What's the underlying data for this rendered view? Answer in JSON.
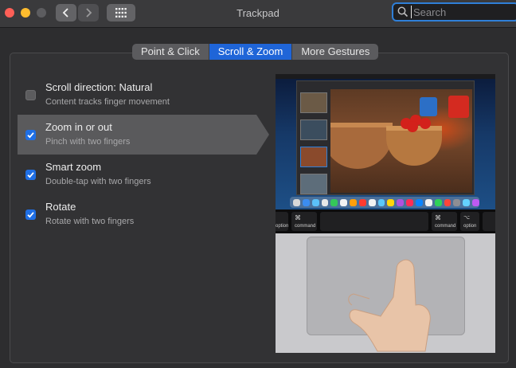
{
  "window": {
    "title": "Trackpad",
    "search": {
      "placeholder": "Search",
      "value": ""
    },
    "back_icon": "chevron-left-icon",
    "forward_icon": "chevron-right-icon",
    "grid_icon": "grid-icon",
    "search_icon": "magnifier-icon"
  },
  "tabs": [
    {
      "label": "Point & Click",
      "active": false
    },
    {
      "label": "Scroll & Zoom",
      "active": true
    },
    {
      "label": "More Gestures",
      "active": false
    }
  ],
  "options": [
    {
      "title": "Scroll direction: Natural",
      "subtitle": "Content tracks finger movement",
      "checked": false,
      "highlighted": false
    },
    {
      "title": "Zoom in or out",
      "subtitle": "Pinch with two fingers",
      "checked": true,
      "highlighted": true
    },
    {
      "title": "Smart zoom",
      "subtitle": "Double-tap with two fingers",
      "checked": true,
      "highlighted": false
    },
    {
      "title": "Rotate",
      "subtitle": "Rotate with two fingers",
      "checked": true,
      "highlighted": false
    }
  ],
  "preview": {
    "keys": [
      "option",
      "command",
      "command",
      "option"
    ],
    "key_symbol": "⌘",
    "key_alt_symbol": "⌥"
  },
  "colors": {
    "accent": "#1f65d8",
    "checkbox_on": "#1f6fe5",
    "highlight_row": "#5a5a5c"
  }
}
